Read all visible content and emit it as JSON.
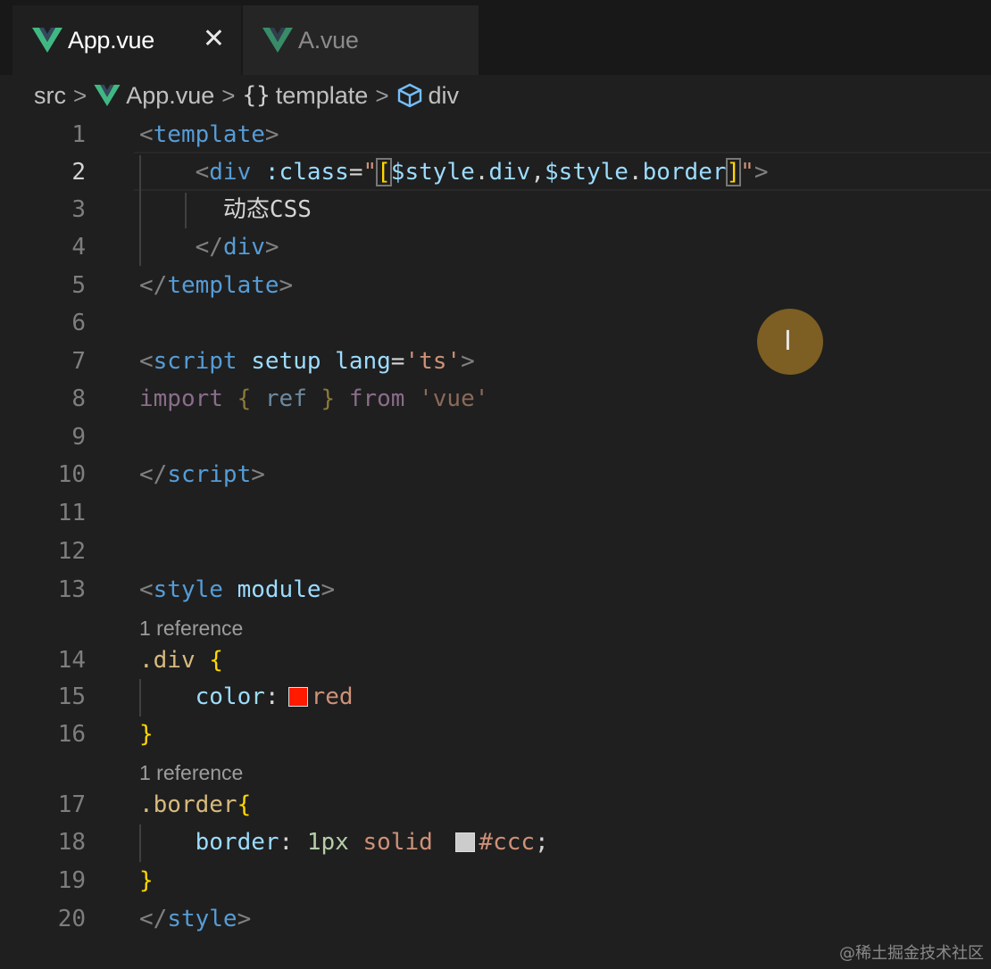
{
  "tabs": [
    {
      "label": "App.vue",
      "active": true,
      "close": "✕"
    },
    {
      "label": "A.vue",
      "active": false
    }
  ],
  "breadcrumb": {
    "items": [
      "src",
      "App.vue",
      "template",
      "div"
    ],
    "separator": ">",
    "brace_icon": "{}"
  },
  "editor": {
    "lines": [
      {
        "n": "1",
        "parts": [
          [
            "<",
            "t-punc"
          ],
          [
            "template",
            "t-tag"
          ],
          [
            ">",
            "t-punc"
          ]
        ]
      },
      {
        "n": "2",
        "parts": [
          [
            "    ",
            "t-op"
          ],
          [
            "<",
            "t-punc"
          ],
          [
            "div",
            "t-tag"
          ],
          [
            " ",
            "t-op"
          ],
          [
            ":class",
            "t-attr"
          ],
          [
            "=",
            "t-op"
          ],
          [
            "\"",
            "t-str"
          ],
          [
            "[",
            "t-bracket"
          ],
          [
            "$style",
            "t-var"
          ],
          [
            ".",
            "t-op"
          ],
          [
            "div",
            "t-var"
          ],
          [
            ",",
            "t-op"
          ],
          [
            "$style",
            "t-var"
          ],
          [
            ".",
            "t-op"
          ],
          [
            "border",
            "t-var"
          ],
          [
            "]",
            "t-bracket"
          ],
          [
            "\"",
            "t-str"
          ],
          [
            ">",
            "t-punc"
          ]
        ]
      },
      {
        "n": "3",
        "parts": [
          [
            "      动态CSS",
            "t-op"
          ]
        ]
      },
      {
        "n": "4",
        "parts": [
          [
            "    ",
            "t-op"
          ],
          [
            "</",
            "t-punc"
          ],
          [
            "div",
            "t-tag"
          ],
          [
            ">",
            "t-punc"
          ]
        ]
      },
      {
        "n": "5",
        "parts": [
          [
            "</",
            "t-punc"
          ],
          [
            "template",
            "t-tag"
          ],
          [
            ">",
            "t-punc"
          ]
        ]
      },
      {
        "n": "6",
        "parts": []
      },
      {
        "n": "7",
        "parts": [
          [
            "<",
            "t-punc"
          ],
          [
            "script",
            "t-tag"
          ],
          [
            " ",
            "t-op"
          ],
          [
            "setup",
            "t-attr"
          ],
          [
            " ",
            "t-op"
          ],
          [
            "lang",
            "t-attr"
          ],
          [
            "=",
            "t-op"
          ],
          [
            "'ts'",
            "t-str"
          ],
          [
            ">",
            "t-punc"
          ]
        ]
      },
      {
        "n": "8",
        "parts": [
          [
            "import",
            "t-kw-dim"
          ],
          [
            " ",
            "t-op"
          ],
          [
            "{",
            "t-brace-dim"
          ],
          [
            " ref ",
            "t-id-dim"
          ],
          [
            "}",
            "t-brace-dim"
          ],
          [
            " ",
            "t-op"
          ],
          [
            "from",
            "t-kw-dim"
          ],
          [
            " ",
            "t-op"
          ],
          [
            "'vue'",
            "t-str-dim"
          ]
        ]
      },
      {
        "n": "9",
        "parts": []
      },
      {
        "n": "10",
        "parts": [
          [
            "</",
            "t-punc"
          ],
          [
            "script",
            "t-tag"
          ],
          [
            ">",
            "t-punc"
          ]
        ]
      },
      {
        "n": "11",
        "parts": []
      },
      {
        "n": "12",
        "parts": []
      },
      {
        "n": "13",
        "parts": [
          [
            "<",
            "t-punc"
          ],
          [
            "style",
            "t-tag"
          ],
          [
            " ",
            "t-op"
          ],
          [
            "module",
            "t-attr"
          ],
          [
            ">",
            "t-punc"
          ]
        ]
      },
      {
        "n": "14",
        "parts": [
          [
            ".div",
            "t-sel"
          ],
          [
            " ",
            "t-op"
          ],
          [
            "{",
            "t-brace"
          ]
        ]
      },
      {
        "n": "15",
        "parts": [
          [
            "    ",
            "t-op"
          ],
          [
            "color",
            "t-prop"
          ],
          [
            ":",
            "t-op"
          ],
          [
            "SWATCH:#ff1a00",
            ""
          ],
          [
            "red",
            "t-val"
          ]
        ]
      },
      {
        "n": "16",
        "parts": [
          [
            "}",
            "t-brace"
          ]
        ]
      },
      {
        "n": "17",
        "parts": [
          [
            ".border",
            "t-sel"
          ],
          [
            "{",
            "t-brace"
          ]
        ]
      },
      {
        "n": "18",
        "parts": [
          [
            "    ",
            "t-op"
          ],
          [
            "border",
            "t-prop"
          ],
          [
            ": ",
            "t-op"
          ],
          [
            "1px",
            "t-num"
          ],
          [
            " ",
            "t-op"
          ],
          [
            "solid",
            "t-val"
          ],
          [
            " ",
            "t-op"
          ],
          [
            "SWATCH:#cccccc",
            ""
          ],
          [
            "#ccc",
            "t-val"
          ],
          [
            ";",
            "t-op"
          ]
        ]
      },
      {
        "n": "19",
        "parts": [
          [
            "}",
            "t-brace"
          ]
        ]
      },
      {
        "n": "20",
        "parts": [
          [
            "</",
            "t-punc"
          ],
          [
            "style",
            "t-tag"
          ],
          [
            ">",
            "t-punc"
          ]
        ]
      }
    ],
    "references": [
      "1 reference",
      "1 reference"
    ],
    "current_line": "2"
  },
  "cursor_icon": "I",
  "watermark": "@稀土掘金技术社区",
  "colors": {
    "vue_green": "#41b883",
    "vue_dark": "#35495e",
    "cursor_highlight": "#7d5e23"
  }
}
